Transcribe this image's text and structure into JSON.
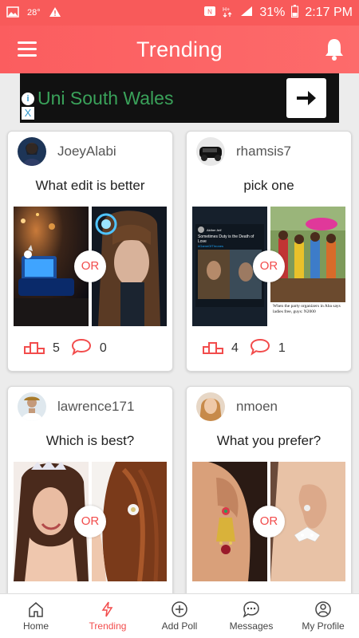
{
  "status_bar": {
    "temperature": "28°",
    "battery": "31%",
    "time": "2:17 PM"
  },
  "app_bar": {
    "title": "Trending"
  },
  "ad": {
    "text": "Uni South Wales",
    "info_icon": "i",
    "close_icon": "X"
  },
  "polls": [
    {
      "username": "JoeyAlabi",
      "question": "What edit is better",
      "or_label": "OR",
      "votes": "5",
      "comments": "0"
    },
    {
      "username": "rhamsis7",
      "question": "pick one",
      "or_label": "OR",
      "votes": "4",
      "comments": "1",
      "tweet": {
        "name": "Akther Arif",
        "text": "Sometimes Duty is the Death of Love",
        "hashtag": "#GameOfThrones"
      },
      "meme_caption": "When the party organizers in Aba says ladies free, guys: N2000"
    },
    {
      "username": "lawrence171",
      "question": "Which is best?",
      "or_label": "OR"
    },
    {
      "username": "nmoen",
      "question": "What you prefer?",
      "or_label": "OR"
    }
  ],
  "bottom_nav": {
    "items": [
      {
        "label": "Home",
        "icon": "home-icon"
      },
      {
        "label": "Trending",
        "icon": "lightning-icon"
      },
      {
        "label": "Add Poll",
        "icon": "plus-circle-icon"
      },
      {
        "label": "Messages",
        "icon": "chat-icon"
      },
      {
        "label": "My Profile",
        "icon": "profile-icon"
      }
    ],
    "active": "Trending"
  },
  "colors": {
    "brand": "#f85a5a",
    "accent": "#f24c4c"
  }
}
